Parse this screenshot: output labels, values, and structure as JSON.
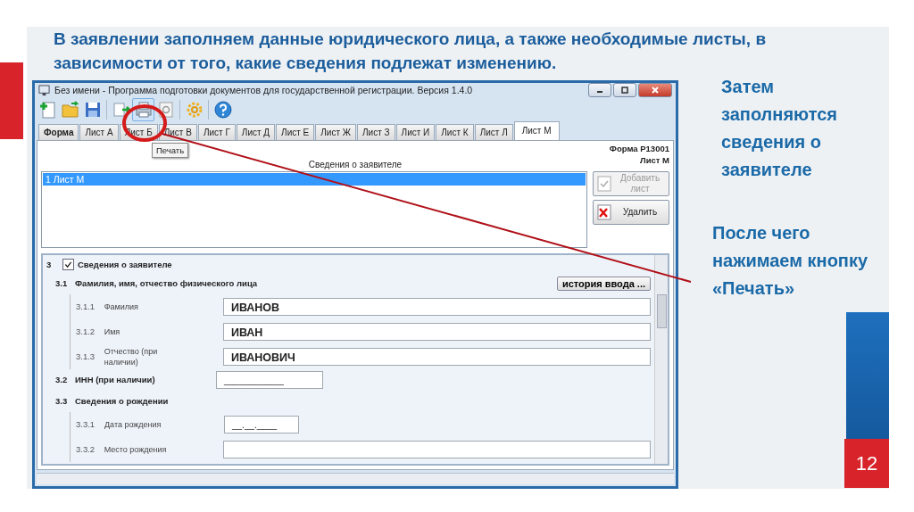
{
  "slide": {
    "heading": "В заявлении заполняем данные юридического лица, а также необходимые листы, в зависимости от того, какие сведения подлежат изменению.",
    "notes": [
      "Затем заполняются сведения о заявителе",
      "После чего нажимаем кнопку «Печать»"
    ],
    "page_number": "12"
  },
  "window": {
    "title": "Без имени - Программа подготовки документов для государственной регистрации. Версия 1.4.0",
    "toolbar": [
      {
        "kind": "new",
        "highlighted": false
      },
      {
        "kind": "open",
        "highlighted": false
      },
      {
        "kind": "save",
        "highlighted": false
      },
      {
        "kind": "export",
        "highlighted": false
      },
      {
        "kind": "print",
        "highlighted": true
      },
      {
        "kind": "preview",
        "highlighted": false
      },
      {
        "kind": "settings",
        "highlighted": false
      },
      {
        "kind": "help",
        "highlighted": false
      }
    ],
    "tooltip": "Печать",
    "tabs": [
      {
        "label": "Форма",
        "selected": false
      },
      {
        "label": "Лист А",
        "selected": false
      },
      {
        "label": "Лист Б",
        "selected": false
      },
      {
        "label": "Лист В",
        "selected": false
      },
      {
        "label": "Лист Г",
        "selected": false
      },
      {
        "label": "Лист Д",
        "selected": false
      },
      {
        "label": "Лист Е",
        "selected": false
      },
      {
        "label": "Лист Ж",
        "selected": false
      },
      {
        "label": "Лист З",
        "selected": false
      },
      {
        "label": "Лист И",
        "selected": false
      },
      {
        "label": "Лист К",
        "selected": false
      },
      {
        "label": "Лист Л",
        "selected": false
      },
      {
        "label": "Лист М",
        "selected": true
      }
    ],
    "form_code": "Форма Р13001",
    "sheet_label": "Лист М",
    "section_title": "Сведения о заявителе",
    "sheets": [
      {
        "label": "1 Лист М",
        "selected": true
      }
    ],
    "buttons": [
      {
        "label": "Добавить лист",
        "kind": "add",
        "disabled": true
      },
      {
        "label": "Удалить",
        "kind": "delete",
        "disabled": false
      }
    ],
    "form": {
      "section": {
        "number": "3",
        "label": "Сведения о заявителе",
        "checked": true
      },
      "history_button": "история ввода ...",
      "groups": [
        {
          "number": "3.1",
          "label": "Фамилия, имя, отчество физического лица",
          "fields": [
            {
              "number": "3.1.1",
              "label": "Фамилия",
              "value": "ИВАНОВ"
            },
            {
              "number": "3.1.2",
              "label": "Имя",
              "value": "ИВАН"
            },
            {
              "number": "3.1.3",
              "label": "Отчество (при наличии)",
              "value": "ИВАНОВИЧ"
            }
          ]
        },
        {
          "number": "3.2",
          "label": "ИНН (при наличии)",
          "value": "____________"
        },
        {
          "number": "3.3",
          "label": "Сведения о рождении",
          "fields": [
            {
              "number": "3.3.1",
              "label": "Дата рождения",
              "value": "__.__.____",
              "short": true
            },
            {
              "number": "3.3.2",
              "label": "Место рождения"
            }
          ]
        }
      ]
    }
  }
}
